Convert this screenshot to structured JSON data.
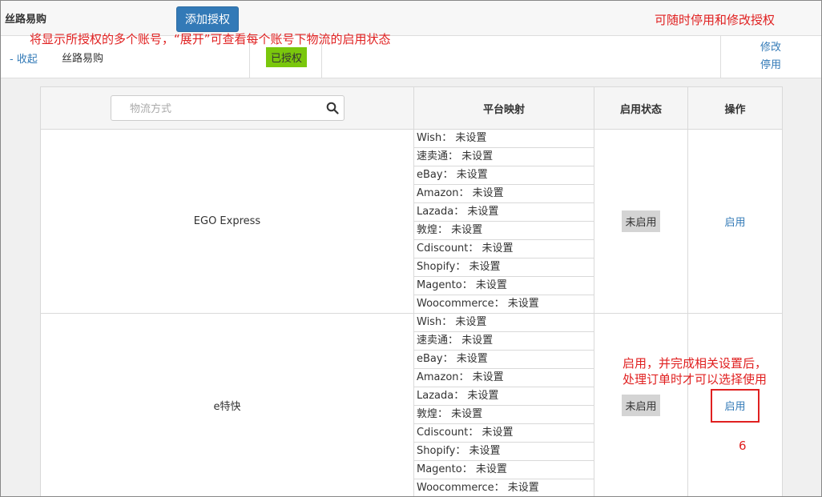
{
  "header": {
    "account_brand": "丝路易购",
    "add_button_label": "添加授权"
  },
  "annotations": {
    "accounts_note": "将显示所授权的多个账号，“展开”可查看每个账号下物流的启用状态",
    "modify_note": "可随时停用和修改授权",
    "enable_note_line1": "启用，并完成相关设置后，",
    "enable_note_line2": "处理订单时才可以选择使用",
    "step_number": "6"
  },
  "account_row": {
    "collapse_label": "- 收起",
    "name": "丝路易购",
    "status": "已授权",
    "actions": [
      "修改",
      "停用"
    ]
  },
  "table": {
    "search_placeholder": "物流方式",
    "columns": [
      "平台映射",
      "启用状态",
      "操作"
    ],
    "rows": [
      {
        "name": "EGO Express",
        "mappings": [
          "Wish： 未设置",
          "速卖通： 未设置",
          "eBay： 未设置",
          "Amazon： 未设置",
          "Lazada： 未设置",
          "敦煌： 未设置",
          "Cdiscount： 未设置",
          "Shopify： 未设置",
          "Magento： 未设置",
          "Woocommerce： 未设置"
        ],
        "status": "未启用",
        "action": "启用"
      },
      {
        "name": "e特快",
        "mappings": [
          "Wish： 未设置",
          "速卖通： 未设置",
          "eBay： 未设置",
          "Amazon： 未设置",
          "Lazada： 未设置",
          "敦煌： 未设置",
          "Cdiscount： 未设置",
          "Shopify： 未设置",
          "Magento： 未设置",
          "Woocommerce： 未设置"
        ],
        "status": "未启用",
        "action": "启用"
      }
    ]
  },
  "colors": {
    "primary": "#337ab7",
    "annotation_red": "#e02020",
    "authorized_green": "#7ac70c",
    "disabled_gray": "#d4d4d4"
  }
}
